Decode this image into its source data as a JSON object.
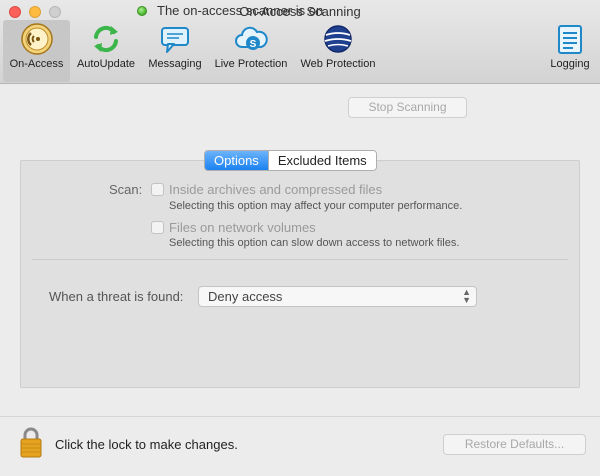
{
  "window": {
    "title": "On-Access Scanning"
  },
  "toolbar": {
    "items": [
      {
        "label": "On-Access",
        "icon": "radar-icon",
        "selected": true
      },
      {
        "label": "AutoUpdate",
        "icon": "refresh-icon"
      },
      {
        "label": "Messaging",
        "icon": "message-icon"
      },
      {
        "label": "Live Protection",
        "icon": "cloud-shield-icon"
      },
      {
        "label": "Web Protection",
        "icon": "globe-icon"
      },
      {
        "label": "Logging",
        "icon": "log-list-icon"
      }
    ]
  },
  "status": {
    "text": "The on-access scanner is on",
    "indicator_color": "#46b22a",
    "stop_button": "Stop Scanning"
  },
  "tabs": [
    {
      "label": "Options",
      "active": true
    },
    {
      "label": "Excluded Items",
      "active": false
    }
  ],
  "scan": {
    "label": "Scan:",
    "options": [
      {
        "label": "Inside archives and compressed files",
        "description": "Selecting this option may affect your computer performance.",
        "checked": false
      },
      {
        "label": "Files on network volumes",
        "description": "Selecting this option can slow down access to network files.",
        "checked": false
      }
    ]
  },
  "threat": {
    "label": "When a threat is found:",
    "selected": "Deny access"
  },
  "footer": {
    "lock_text": "Click the lock to make changes.",
    "restore_button": "Restore Defaults..."
  },
  "colors": {
    "accent": "#1b82f2"
  }
}
